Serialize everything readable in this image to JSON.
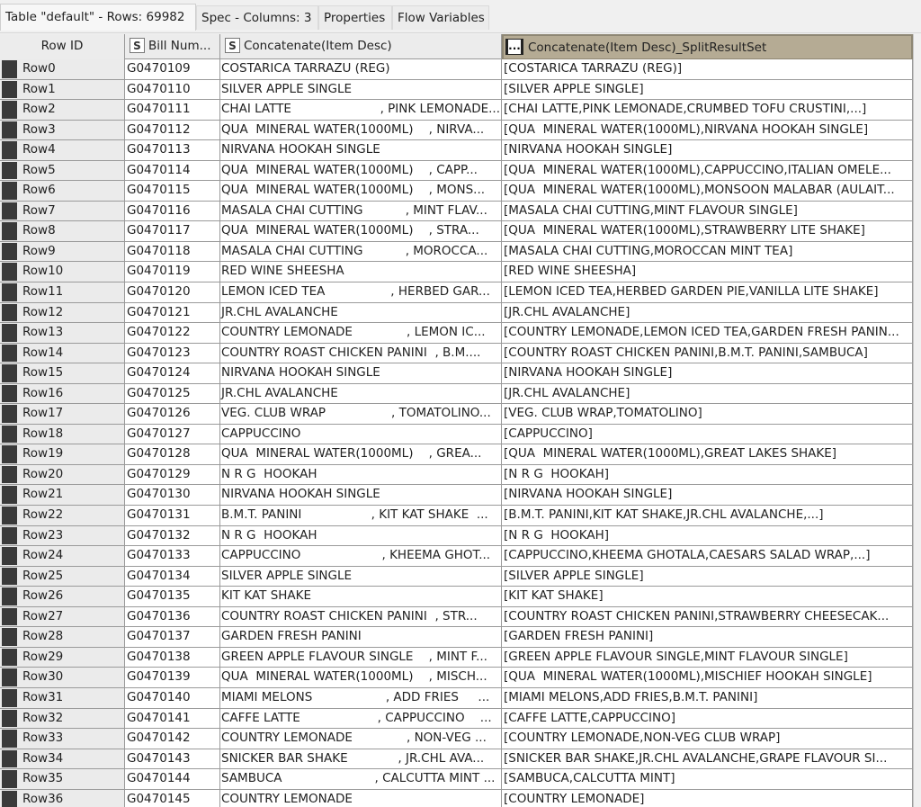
{
  "tabs": [
    {
      "label": "Table \"default\" - Rows: 69982",
      "active": true
    },
    {
      "label": "Spec - Columns: 3",
      "active": false
    },
    {
      "label": "Properties",
      "active": false
    },
    {
      "label": "Flow Variables",
      "active": false
    }
  ],
  "table": {
    "columns": [
      {
        "label": "Row ID",
        "type_icon": ""
      },
      {
        "label": "Bill Num...",
        "type_icon": "S"
      },
      {
        "label": "Concatenate(Item Desc)",
        "type_icon": "S"
      },
      {
        "label": "Concatenate(Item Desc)_SplitResultSet",
        "type_icon": "..."
      }
    ],
    "rows": [
      [
        "Row0",
        "G0470109",
        "COSTARICA TARRAZU (REG)",
        "[COSTARICA TARRAZU (REG)]"
      ],
      [
        "Row1",
        "G0470110",
        "SILVER APPLE SINGLE",
        "[SILVER APPLE SINGLE]"
      ],
      [
        "Row2",
        "G0470111",
        "CHAI LATTE                       , PINK LEMONADE...",
        "[CHAI LATTE,PINK LEMONADE,CRUMBED TOFU CRUSTINI,...]"
      ],
      [
        "Row3",
        "G0470112",
        "QUA  MINERAL WATER(1000ML)    , NIRVA...",
        "[QUA  MINERAL WATER(1000ML),NIRVANA HOOKAH SINGLE]"
      ],
      [
        "Row4",
        "G0470113",
        "NIRVANA HOOKAH SINGLE",
        "[NIRVANA HOOKAH SINGLE]"
      ],
      [
        "Row5",
        "G0470114",
        "QUA  MINERAL WATER(1000ML)    , CAPP...",
        "[QUA  MINERAL WATER(1000ML),CAPPUCCINO,ITALIAN OMELE..."
      ],
      [
        "Row6",
        "G0470115",
        "QUA  MINERAL WATER(1000ML)    , MONS...",
        "[QUA  MINERAL WATER(1000ML),MONSOON MALABAR (AULAIT..."
      ],
      [
        "Row7",
        "G0470116",
        "MASALA CHAI CUTTING           , MINT FLAV...",
        "[MASALA CHAI CUTTING,MINT FLAVOUR SINGLE]"
      ],
      [
        "Row8",
        "G0470117",
        "QUA  MINERAL WATER(1000ML)    , STRA...",
        "[QUA  MINERAL WATER(1000ML),STRAWBERRY LITE SHAKE]"
      ],
      [
        "Row9",
        "G0470118",
        "MASALA CHAI CUTTING           , MOROCCA...",
        "[MASALA CHAI CUTTING,MOROCCAN MINT TEA]"
      ],
      [
        "Row10",
        "G0470119",
        "RED WINE SHEESHA",
        "[RED WINE SHEESHA]"
      ],
      [
        "Row11",
        "G0470120",
        "LEMON ICED TEA                 , HERBED GAR...",
        "[LEMON ICED TEA,HERBED GARDEN PIE,VANILLA LITE SHAKE]"
      ],
      [
        "Row12",
        "G0470121",
        "JR.CHL AVALANCHE",
        "[JR.CHL AVALANCHE]"
      ],
      [
        "Row13",
        "G0470122",
        "COUNTRY LEMONADE              , LEMON IC...",
        "[COUNTRY LEMONADE,LEMON ICED TEA,GARDEN FRESH PANIN..."
      ],
      [
        "Row14",
        "G0470123",
        "COUNTRY ROAST CHICKEN PANINI  , B.M....",
        "[COUNTRY ROAST CHICKEN PANINI,B.M.T. PANINI,SAMBUCA]"
      ],
      [
        "Row15",
        "G0470124",
        "NIRVANA HOOKAH SINGLE",
        "[NIRVANA HOOKAH SINGLE]"
      ],
      [
        "Row16",
        "G0470125",
        "JR.CHL AVALANCHE",
        "[JR.CHL AVALANCHE]"
      ],
      [
        "Row17",
        "G0470126",
        "VEG. CLUB WRAP                 , TOMATOLINO...",
        "[VEG. CLUB WRAP,TOMATOLINO]"
      ],
      [
        "Row18",
        "G0470127",
        "CAPPUCCINO",
        "[CAPPUCCINO]"
      ],
      [
        "Row19",
        "G0470128",
        "QUA  MINERAL WATER(1000ML)    , GREA...",
        "[QUA  MINERAL WATER(1000ML),GREAT LAKES SHAKE]"
      ],
      [
        "Row20",
        "G0470129",
        "N R G  HOOKAH",
        "[N R G  HOOKAH]"
      ],
      [
        "Row21",
        "G0470130",
        "NIRVANA HOOKAH SINGLE",
        "[NIRVANA HOOKAH SINGLE]"
      ],
      [
        "Row22",
        "G0470131",
        "B.M.T. PANINI                  , KIT KAT SHAKE  ...",
        "[B.M.T. PANINI,KIT KAT SHAKE,JR.CHL AVALANCHE,...]"
      ],
      [
        "Row23",
        "G0470132",
        "N R G  HOOKAH",
        "[N R G  HOOKAH]"
      ],
      [
        "Row24",
        "G0470133",
        "CAPPUCCINO                     , KHEEMA GHOT...",
        "[CAPPUCCINO,KHEEMA GHOTALA,CAESARS SALAD WRAP,...]"
      ],
      [
        "Row25",
        "G0470134",
        "SILVER APPLE SINGLE",
        "[SILVER APPLE SINGLE]"
      ],
      [
        "Row26",
        "G0470135",
        "KIT KAT SHAKE",
        "[KIT KAT SHAKE]"
      ],
      [
        "Row27",
        "G0470136",
        "COUNTRY ROAST CHICKEN PANINI  , STR...",
        "[COUNTRY ROAST CHICKEN PANINI,STRAWBERRY CHEESECAK..."
      ],
      [
        "Row28",
        "G0470137",
        "GARDEN FRESH PANINI",
        "[GARDEN FRESH PANINI]"
      ],
      [
        "Row29",
        "G0470138",
        "GREEN APPLE FLAVOUR SINGLE    , MINT F...",
        "[GREEN APPLE FLAVOUR SINGLE,MINT FLAVOUR SINGLE]"
      ],
      [
        "Row30",
        "G0470139",
        "QUA  MINERAL WATER(1000ML)    , MISCH...",
        "[QUA  MINERAL WATER(1000ML),MISCHIEF HOOKAH SINGLE]"
      ],
      [
        "Row31",
        "G0470140",
        "MIAMI MELONS                   , ADD FRIES     ...",
        "[MIAMI MELONS,ADD FRIES,B.M.T. PANINI]"
      ],
      [
        "Row32",
        "G0470141",
        "CAFFE LATTE                    , CAPPUCCINO    ...",
        "[CAFFE LATTE,CAPPUCCINO]"
      ],
      [
        "Row33",
        "G0470142",
        "COUNTRY LEMONADE              , NON-VEG ...",
        "[COUNTRY LEMONADE,NON-VEG CLUB WRAP]"
      ],
      [
        "Row34",
        "G0470143",
        "SNICKER BAR SHAKE             , JR.CHL AVA...",
        "[SNICKER BAR SHAKE,JR.CHL AVALANCHE,GRAPE FLAVOUR SI..."
      ],
      [
        "Row35",
        "G0470144",
        "SAMBUCA                        , CALCUTTA MINT ...",
        "[SAMBUCA,CALCUTTA MINT]"
      ],
      [
        "Row36",
        "G0470145",
        "COUNTRY LEMONADE",
        "[COUNTRY LEMONADE]"
      ]
    ]
  }
}
